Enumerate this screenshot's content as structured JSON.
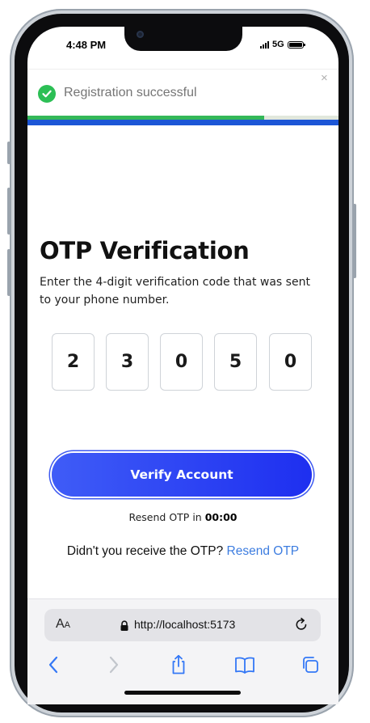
{
  "status_bar": {
    "time": "4:48 PM",
    "network": "5G"
  },
  "toast": {
    "message": "Registration successful",
    "close_glyph": "×",
    "progress_fraction": 0.76,
    "colors": {
      "success": "#2cbf55",
      "progress": "#34b858",
      "accent_bar": "#1c56d6"
    }
  },
  "page": {
    "title": "OTP Verification",
    "subtitle": "Enter the 4-digit verification code that was sent to your phone number."
  },
  "otp": {
    "digits": [
      "2",
      "3",
      "0",
      "5",
      "0"
    ]
  },
  "verify_button": {
    "label": "Verify Account"
  },
  "resend_timer": {
    "prefix": "Resend OTP in",
    "time": "00:00"
  },
  "not_received": {
    "question": "Didn't you receive the OTP?",
    "link": "Resend OTP"
  },
  "browser": {
    "text_size_big": "A",
    "text_size_small": "A",
    "url": "http://localhost:5173"
  },
  "icons": [
    "check-circle-icon",
    "close-icon",
    "lock-icon",
    "reload-icon",
    "back-icon",
    "forward-icon",
    "share-icon",
    "bookmarks-icon",
    "tabs-icon"
  ]
}
